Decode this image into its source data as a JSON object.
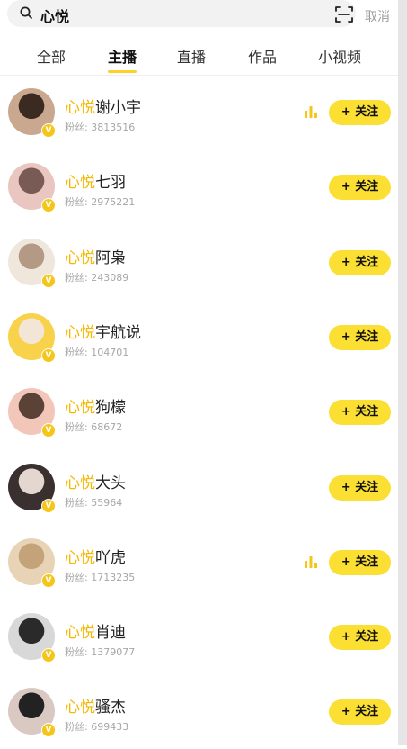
{
  "search": {
    "query": "心悦",
    "cancel_label": "取消"
  },
  "tabs": [
    {
      "label": "全部",
      "active": false
    },
    {
      "label": "主播",
      "active": true
    },
    {
      "label": "直播",
      "active": false
    },
    {
      "label": "作品",
      "active": false
    },
    {
      "label": "小视频",
      "active": false
    }
  ],
  "follow_label": "+ 关注",
  "highlight": "心悦",
  "results": [
    {
      "name_rest": "谢小宇",
      "fans": "粉丝: 3813516",
      "live": true
    },
    {
      "name_rest": "七羽",
      "fans": "粉丝: 2975221",
      "live": false
    },
    {
      "name_rest": "阿枭",
      "fans": "粉丝: 243089",
      "live": false
    },
    {
      "name_rest": "宇航说",
      "fans": "粉丝: 104701",
      "live": false
    },
    {
      "name_rest": "狗檬",
      "fans": "粉丝: 68672",
      "live": false
    },
    {
      "name_rest": "大头",
      "fans": "粉丝: 55964",
      "live": false
    },
    {
      "name_rest": "吖虎",
      "fans": "粉丝: 1713235",
      "live": true
    },
    {
      "name_rest": "肖迪",
      "fans": "粉丝: 1379077",
      "live": false
    },
    {
      "name_rest": "骚杰",
      "fans": "粉丝: 699433",
      "live": false
    }
  ],
  "colors": {
    "accent": "#fcdf33",
    "highlight": "#f5b800",
    "badge": "#f5c518"
  }
}
